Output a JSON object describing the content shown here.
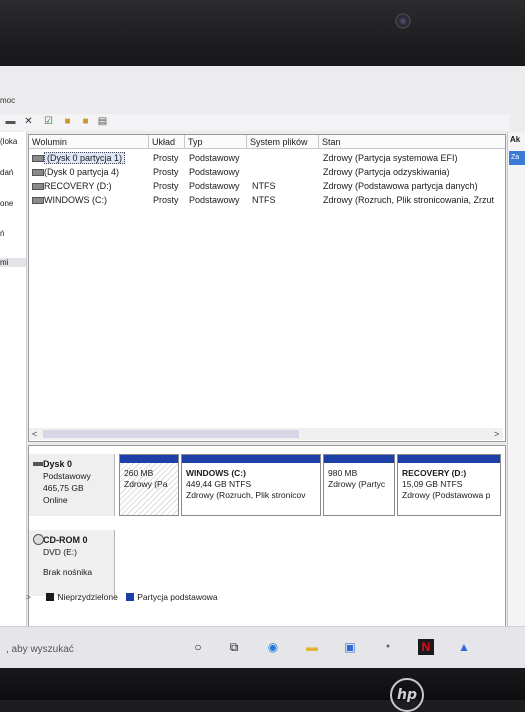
{
  "window": {
    "menu_fragment": "moc",
    "left_panel_items": [
      "(loka",
      "dań",
      "one",
      "ń",
      "mi"
    ],
    "right_panel": {
      "header": "Ak",
      "item": "Za"
    }
  },
  "table": {
    "columns": [
      "Wolumin",
      "Układ",
      "Typ",
      "System plików",
      "Stan"
    ],
    "rows": [
      [
        "(Dysk 0 partycja 1)",
        "Prosty",
        "Podstawowy",
        "",
        "Zdrowy (Partycja systemowa EFI)"
      ],
      [
        "(Dysk 0 partycja 4)",
        "Prosty",
        "Podstawowy",
        "",
        "Zdrowy (Partycja odzyskiwania)"
      ],
      [
        "RECOVERY (D:)",
        "Prosty",
        "Podstawowy",
        "NTFS",
        "Zdrowy (Podstawowa partycja danych)"
      ],
      [
        "WINDOWS (C:)",
        "Prosty",
        "Podstawowy",
        "NTFS",
        "Zdrowy (Rozruch, Plik stronicowania, Zrzut"
      ]
    ],
    "scroll_left": "<",
    "scroll_right": ">"
  },
  "disks": {
    "disk0": {
      "name": "Dysk 0",
      "type": "Podstawowy",
      "size": "465,75 GB",
      "status": "Online",
      "partitions": [
        {
          "name": "",
          "size": "260 MB",
          "status": "Zdrowy (Pa"
        },
        {
          "name": "WINDOWS  (C:)",
          "size": "449,44 GB NTFS",
          "status": "Zdrowy (Rozruch, Plik stronicov"
        },
        {
          "name": "",
          "size": "980 MB",
          "status": "Zdrowy (Partyc"
        },
        {
          "name": "RECOVERY  (D:)",
          "size": "15,09 GB NTFS",
          "status": "Zdrowy (Podstawowa p"
        }
      ]
    },
    "cdrom": {
      "name": "CD-ROM 0",
      "type": "DVD (E:)",
      "status": "Brak nośnika"
    }
  },
  "legend": {
    "arrow": ">",
    "unallocated": "Nieprzydzielone",
    "primary": "Partycja podstawowa",
    "colors": {
      "unallocated": "#1a1a1a",
      "primary": "#1f3fa8"
    }
  },
  "taskbar": {
    "search_text": ", aby wyszukać",
    "apps": [
      "cortana-icon",
      "task-view-icon",
      "edge-icon",
      "explorer-icon",
      "store-icon",
      "mail-icon",
      "netflix-icon",
      "app-icon"
    ]
  }
}
